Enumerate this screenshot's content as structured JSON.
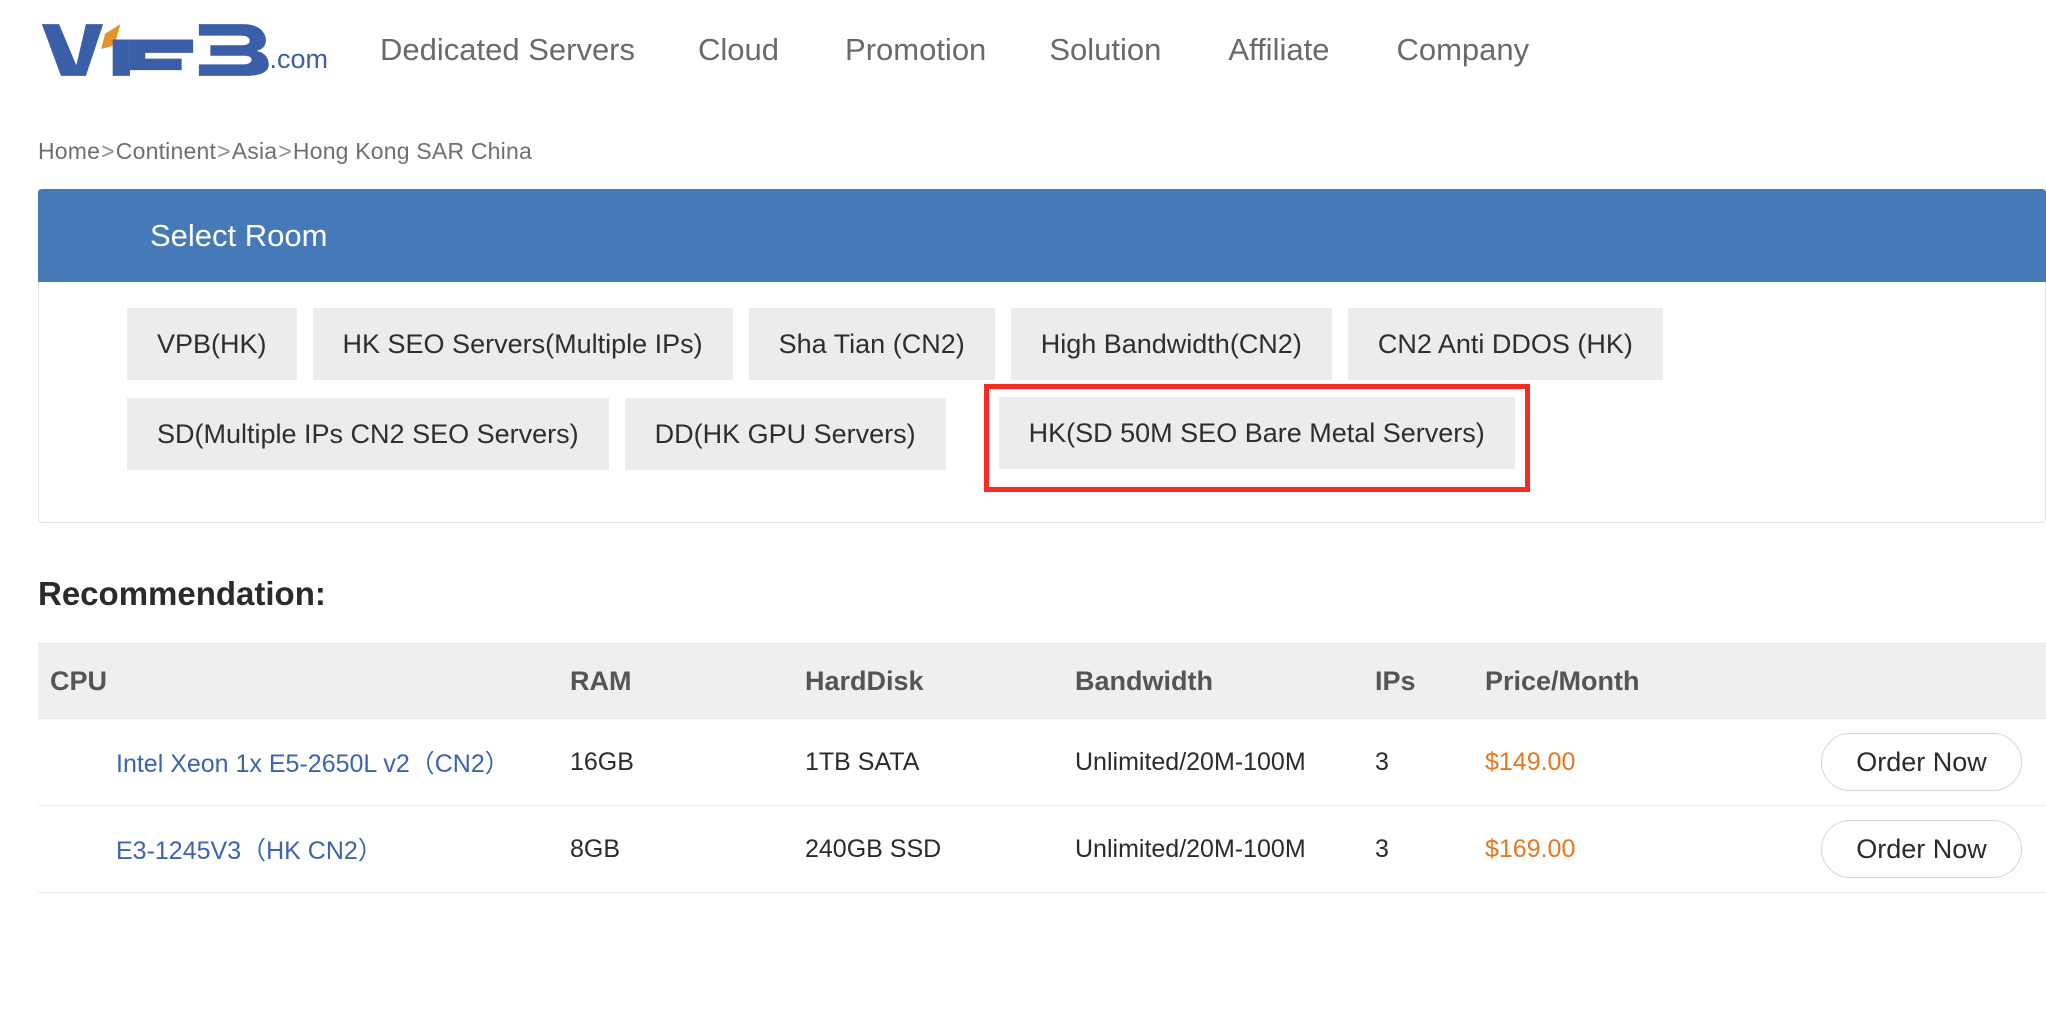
{
  "header": {
    "logo": {
      "text": "VPB",
      "suffix": ".com",
      "primary_color": "#3a5fa8",
      "accent_color": "#e8912a"
    },
    "nav": [
      {
        "label": "Dedicated Servers"
      },
      {
        "label": "Cloud"
      },
      {
        "label": "Promotion"
      },
      {
        "label": "Solution"
      },
      {
        "label": "Affiliate"
      },
      {
        "label": "Company"
      }
    ]
  },
  "breadcrumb": {
    "separator": ">",
    "items": [
      {
        "label": "Home"
      },
      {
        "label": "Continent"
      },
      {
        "label": "Asia"
      },
      {
        "label": "Hong Kong SAR China"
      }
    ]
  },
  "select_room": {
    "title": "Select Room",
    "header_color": "#4679b8",
    "highlight_color": "#f92a23",
    "rows": [
      [
        {
          "label": "VPB(HK)",
          "highlighted": false
        },
        {
          "label": "HK SEO Servers(Multiple IPs)",
          "highlighted": false
        },
        {
          "label": "Sha Tian (CN2)",
          "highlighted": false
        },
        {
          "label": "High Bandwidth(CN2)",
          "highlighted": false
        },
        {
          "label": "CN2 Anti DDOS (HK)",
          "highlighted": false
        }
      ],
      [
        {
          "label": "SD(Multiple IPs CN2 SEO Servers)",
          "highlighted": false
        },
        {
          "label": "DD(HK GPU Servers)",
          "highlighted": false
        },
        {
          "label": "HK(SD 50M SEO Bare Metal Servers)",
          "highlighted": true
        }
      ]
    ]
  },
  "recommendation": {
    "title": "Recommendation:",
    "columns": [
      "CPU",
      "RAM",
      "HardDisk",
      "Bandwidth",
      "IPs",
      "Price/Month",
      ""
    ],
    "rows": [
      {
        "cpu": "Intel Xeon 1x E5-2650L v2（CN2）",
        "ram": "16GB",
        "harddisk": "1TB SATA",
        "bandwidth": "Unlimited/20M-100M",
        "ips": "3",
        "price": "$149.00",
        "action": "Order Now"
      },
      {
        "cpu": "E3-1245V3（HK CN2）",
        "ram": "8GB",
        "harddisk": "240GB SSD",
        "bandwidth": "Unlimited/20M-100M",
        "ips": "3",
        "price": "$169.00",
        "action": "Order Now"
      }
    ]
  }
}
